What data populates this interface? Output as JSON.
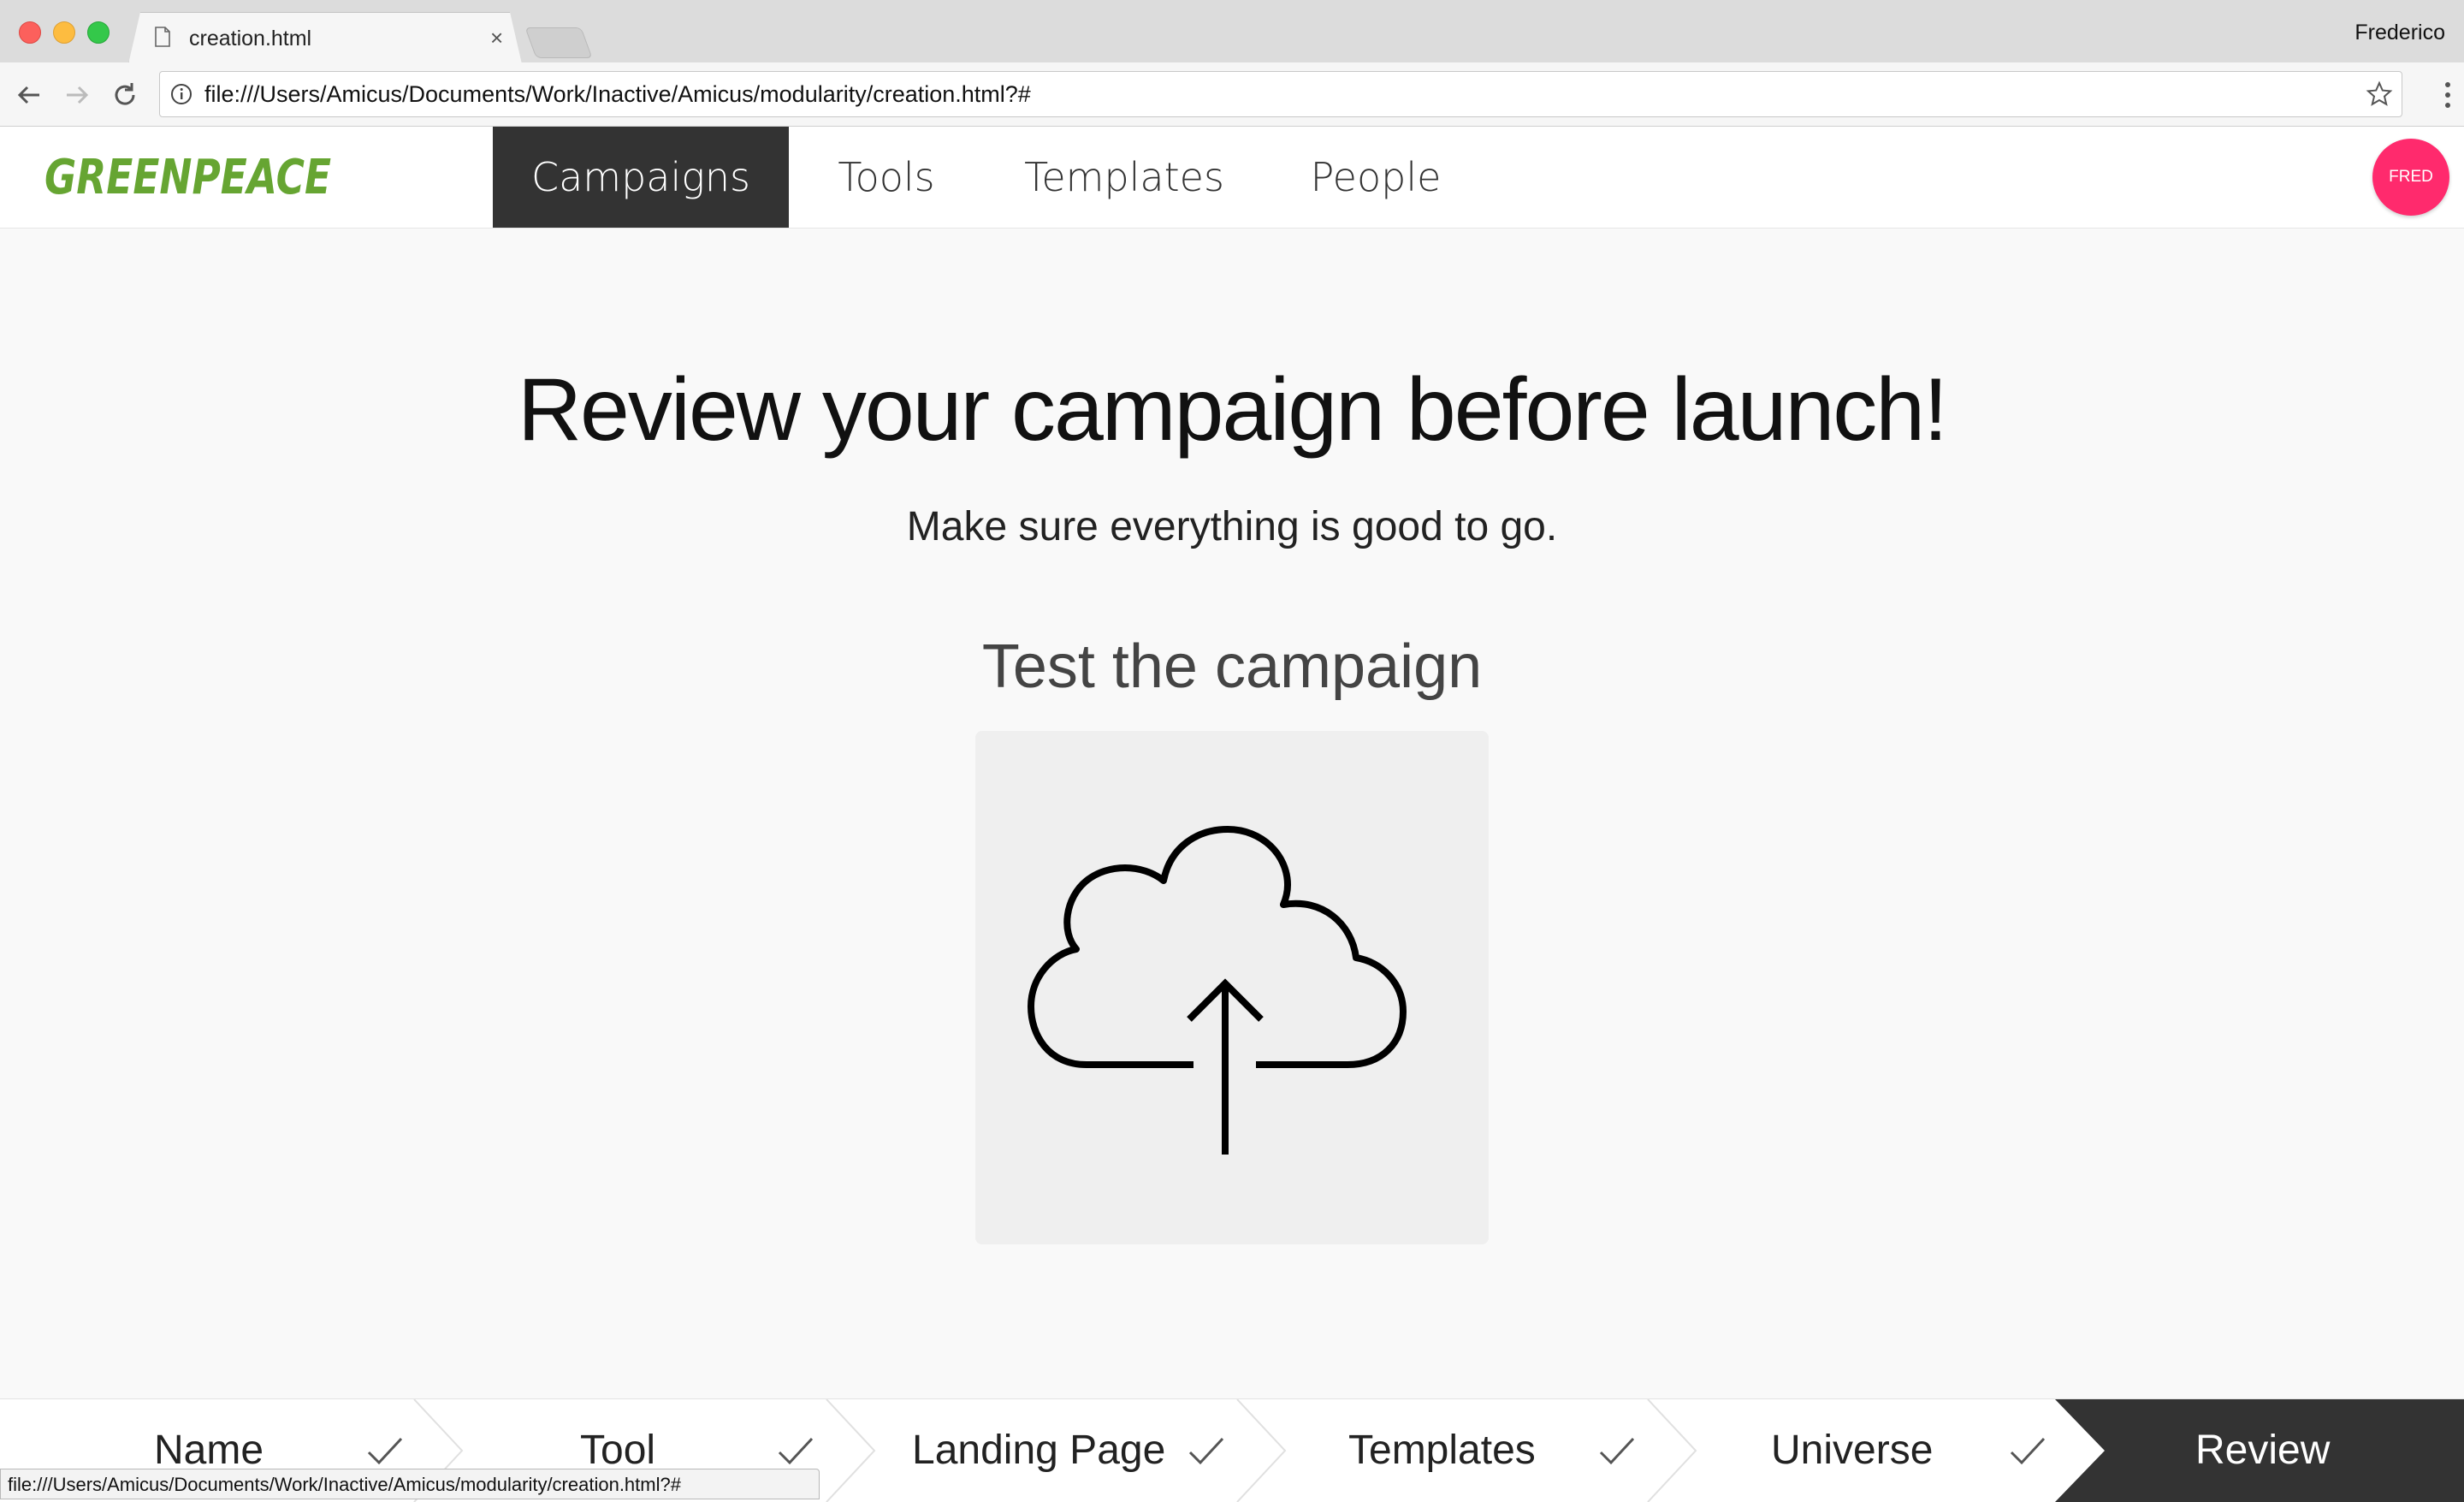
{
  "browser": {
    "tab_title": "creation.html",
    "tab_close": "×",
    "profile_name": "Frederico",
    "url": "file:///Users/Amicus/Documents/Work/Inactive/Amicus/modularity/creation.html?#"
  },
  "app": {
    "logo_text": "GREENPEACE",
    "brand_color": "#66a532",
    "accent_color": "#ff2a6d",
    "nav": [
      "Campaigns",
      "Tools",
      "Templates",
      "People"
    ],
    "active_nav": "Campaigns",
    "avatar_text": "FRED"
  },
  "main": {
    "title": "Review your campaign before launch!",
    "subtitle": "Make sure everything is good to go.",
    "section_title": "Test the campaign",
    "upload_icon": "cloud-upload-icon"
  },
  "steps": [
    {
      "label": "Name",
      "done": true
    },
    {
      "label": "Tool",
      "done": true
    },
    {
      "label": "Landing Page",
      "done": true
    },
    {
      "label": "Templates",
      "done": true
    },
    {
      "label": "Universe",
      "done": true
    },
    {
      "label": "Review",
      "done": false,
      "active": true
    }
  ],
  "status_bar": {
    "url": "file:///Users/Amicus/Documents/Work/Inactive/Amicus/modularity/creation.html?#"
  }
}
